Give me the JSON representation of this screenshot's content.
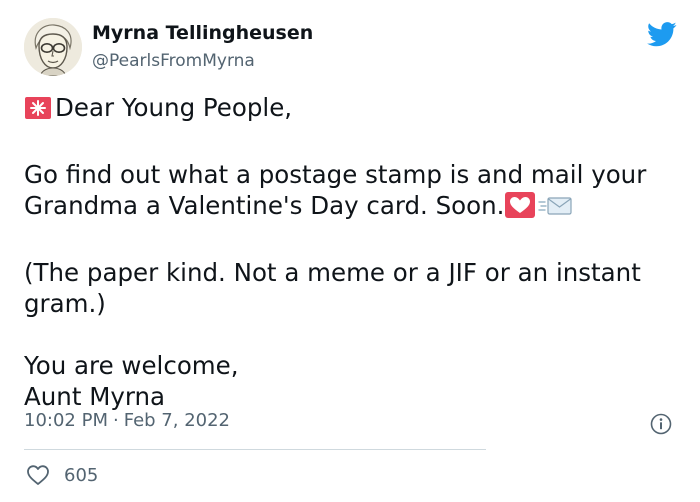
{
  "author": {
    "name": "Myrna Tellingheusen",
    "handle": "@PearlsFromMyrna"
  },
  "tweet": {
    "greeting": "Dear Young People,",
    "para2_line1": "Go find out what a postage stamp is and mail your",
    "para2_line2": "Grandma a Valentine's Day card. Soon.",
    "para3_line1": "(The paper kind. Not a meme or a JIF or an instant",
    "para3_line2": "gram.)",
    "closing_line1": "You are welcome,",
    "closing_line2": "Aunt Myrna"
  },
  "meta": {
    "time": "10:02 PM",
    "separator": "·",
    "date": "Feb 7, 2022"
  },
  "engagement": {
    "likes": "605"
  },
  "icons": {
    "brand": "twitter-bird-icon",
    "info": "info-icon",
    "like": "heart-outline-icon",
    "emoji_1": "rotating-light-emoji",
    "emoji_2": "heart-letter-emoji",
    "emoji_3": "envelope-emoji"
  },
  "colors": {
    "brand_blue": "#1d9bf0",
    "text_primary": "#0f1419",
    "text_secondary": "#536471",
    "divider": "#cfd9de",
    "emoji_red": "#e8435a"
  }
}
